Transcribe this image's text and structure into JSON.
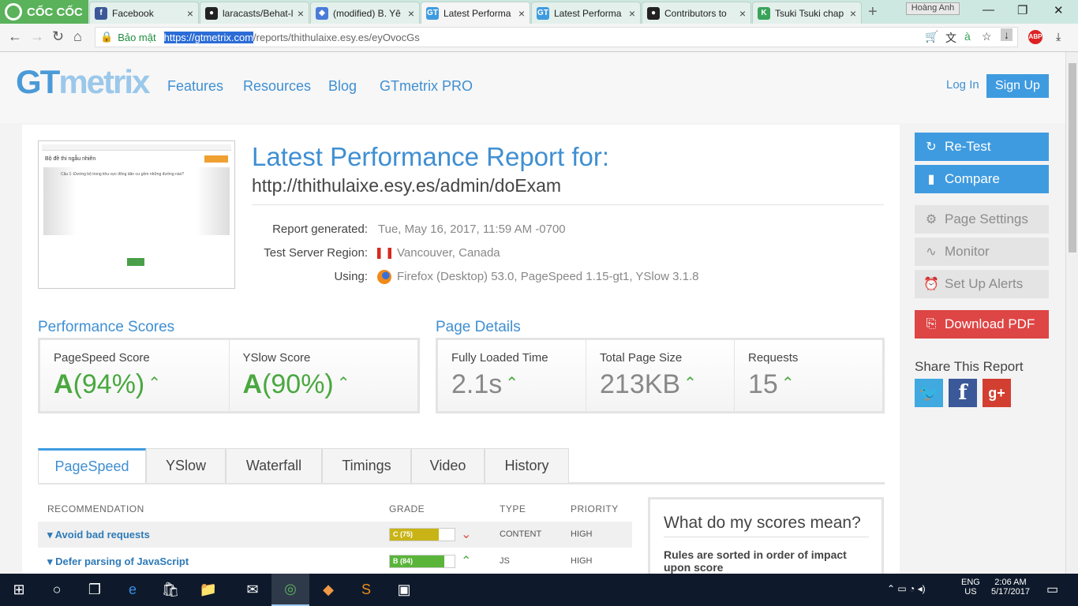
{
  "browser": {
    "brand": "CỐC CỐC",
    "tabs": [
      {
        "label": "Facebook",
        "icon": "facebook-icon",
        "color": "#3b5998",
        "glyph": "f"
      },
      {
        "label": "laracasts/Behat-l",
        "icon": "github-icon",
        "color": "#222222",
        "glyph": "●"
      },
      {
        "label": "(modified) B. Yê",
        "icon": "stack-icon",
        "color": "#4a7bd8",
        "glyph": "◆"
      },
      {
        "label": "Latest Performa",
        "icon": "gtmetrix-icon",
        "color": "#3f9be0",
        "glyph": "GT",
        "active": true
      },
      {
        "label": "Latest Performa",
        "icon": "gtmetrix-icon",
        "color": "#3f9be0",
        "glyph": "GT"
      },
      {
        "label": "Contributors to",
        "icon": "github-icon",
        "color": "#222222",
        "glyph": "●"
      },
      {
        "label": "Tsuki Tsuki chap",
        "icon": "manga-icon",
        "color": "#3aa35a",
        "glyph": "K"
      }
    ],
    "user": "Hoàng Anh",
    "secure_label": "Bảo mật",
    "url_highlight": "https://gtmetrix.com",
    "url_rest": "/reports/thithulaixe.esy.es/eyOvocGs"
  },
  "header": {
    "logo": "GTmetrix",
    "menu": [
      "Features",
      "Resources",
      "Blog",
      "GTmetrix PRO"
    ],
    "login": "Log In",
    "signup": "Sign Up"
  },
  "report": {
    "title": "Latest Performance Report for:",
    "url": "http://thithulaixe.esy.es/admin/doExam",
    "thumb_heading": "Bộ đề thi ngẫu nhiên",
    "thumb_question": "Câu 1: Đường bộ trong khu vực đông dân cư gồm những đường nào?",
    "generated_label": "Report generated:",
    "generated": "Tue, May 16, 2017, 11:59 AM -0700",
    "region_label": "Test Server Region:",
    "region": "Vancouver, Canada",
    "using_label": "Using:",
    "using": "Firefox (Desktop) 53.0, PageSpeed 1.15-gt1, YSlow 3.1.8"
  },
  "performance": {
    "title": "Performance Scores",
    "pagespeed_label": "PageSpeed Score",
    "pagespeed_grade": "A",
    "pagespeed_pct": "(94%)",
    "yslow_label": "YSlow Score",
    "yslow_grade": "A",
    "yslow_pct": "(90%)"
  },
  "details": {
    "title": "Page Details",
    "loaded_label": "Fully Loaded Time",
    "loaded": "2.1s",
    "size_label": "Total Page Size",
    "size": "213KB",
    "requests_label": "Requests",
    "requests": "15"
  },
  "tabs": [
    "PageSpeed",
    "YSlow",
    "Waterfall",
    "Timings",
    "Video",
    "History"
  ],
  "table": {
    "headers": [
      "RECOMMENDATION",
      "GRADE",
      "TYPE",
      "PRIORITY"
    ],
    "rows": [
      {
        "name": "Avoid bad requests",
        "grade": "C (75)",
        "score": 75,
        "color": "#c8b416",
        "trend": "down",
        "type": "CONTENT",
        "priority": "HIGH"
      },
      {
        "name": "Defer parsing of JavaScript",
        "grade": "B (84)",
        "score": 84,
        "color": "#5ab43a",
        "trend": "up",
        "type": "JS",
        "priority": "HIGH"
      }
    ]
  },
  "scores_box": {
    "title": "What do my scores mean?",
    "desc": "Rules are sorted in order of impact upon score"
  },
  "sidebar": {
    "retest": "Re-Test",
    "compare": "Compare",
    "settings": "Page Settings",
    "monitor": "Monitor",
    "alerts": "Set Up Alerts",
    "pdf": "Download PDF",
    "share": "Share This Report"
  },
  "taskbar": {
    "lang": "ENG",
    "region": "US",
    "time": "2:06 AM",
    "date": "5/17/2017"
  }
}
